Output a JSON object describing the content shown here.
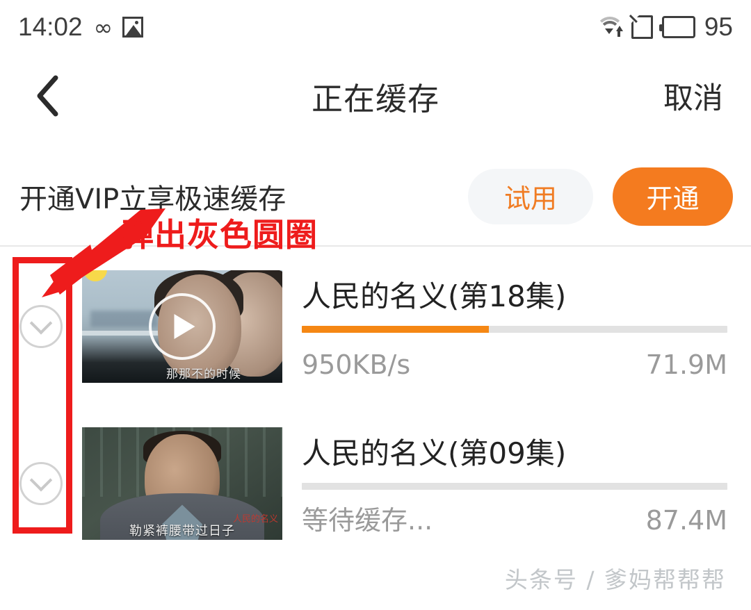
{
  "status_bar": {
    "time": "14:02",
    "infinity_icon": "infinity-icon",
    "image_icon": "image-icon",
    "wifi_icon": "wifi-icon",
    "sd_card_icon": "sd-card-icon",
    "battery_icon": "battery-icon",
    "battery_level": "95"
  },
  "nav": {
    "back_icon": "back-chevron-icon",
    "title": "正在缓存",
    "cancel_label": "取消"
  },
  "vip_banner": {
    "text": "开通VIP立享极速缓存",
    "trial_label": "试用",
    "activate_label": "开通",
    "trial_color": "#f07c23",
    "activate_bg": "#f47b1f"
  },
  "downloads": [
    {
      "checkbox_icon": "circle-chevron-down-icon",
      "title": "人民的名义(第18集)",
      "progress_percent": 44,
      "progress_color": "#f58714",
      "speed": "950KB/s",
      "size": "71.9M",
      "thumb_subtitle": "那那不的时候",
      "play_icon": "play-icon"
    },
    {
      "checkbox_icon": "circle-chevron-down-icon",
      "title": "人民的名义(第09集)",
      "progress_percent": 0,
      "progress_color": "#f58714",
      "speed": "等待缓存...",
      "size": "87.4M",
      "thumb_subtitle": "勒紧裤腰带过日子",
      "thumb_watermark": "人民的名义"
    }
  ],
  "annotation": {
    "text": "弹出灰色圆圈",
    "color": "#ee1c1c"
  },
  "watermark": {
    "text": "头条号 / 爹妈帮帮帮"
  }
}
